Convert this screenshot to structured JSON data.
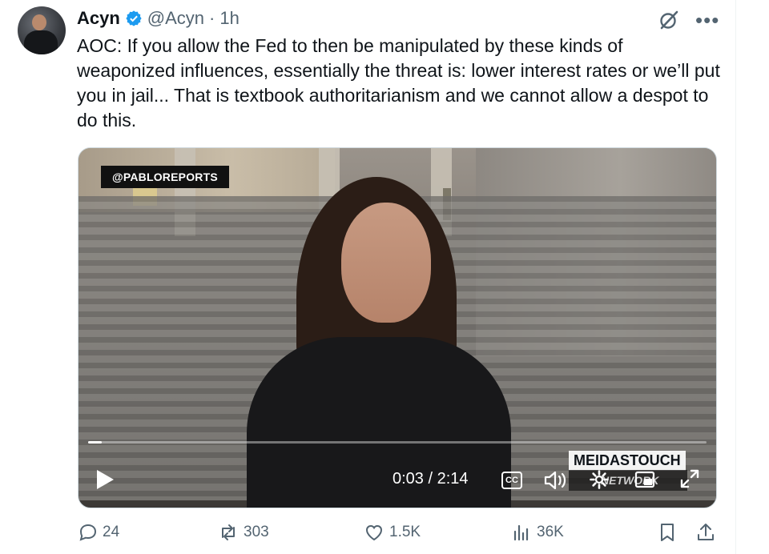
{
  "tweet": {
    "display_name": "Acyn",
    "handle": "@Acyn",
    "separator": "·",
    "time": "1h",
    "text": "AOC: If you allow the Fed to then be manipulated by these kinds of weaponized influences, essentially the threat is: lower interest rates or we’ll put you in jail... That is textbook authoritarianism and we cannot allow a despot to do this."
  },
  "video": {
    "watermark": "@PABLOREPORTS",
    "brand": "MEIDASTOUCH",
    "brand_sub": "NETWORK",
    "current_time": "0:03",
    "duration": "2:14",
    "time_display": "0:03 / 2:14",
    "progress": 0.022,
    "cc_label": "CC"
  },
  "actions": {
    "replies": "24",
    "reposts": "303",
    "likes": "1.5K",
    "views": "36K"
  },
  "colors": {
    "text": "#0f1419",
    "secondary": "#536471",
    "verified": "#1d9bf0",
    "divider": "#eff3f4"
  },
  "icons": [
    "verified-badge-icon",
    "grok-icon",
    "more-icon",
    "play-icon",
    "closed-captions-icon",
    "volume-icon",
    "settings-gear-icon",
    "picture-in-picture-icon",
    "fullscreen-icon",
    "reply-icon",
    "repost-icon",
    "like-icon",
    "views-icon",
    "bookmark-icon",
    "share-icon"
  ]
}
